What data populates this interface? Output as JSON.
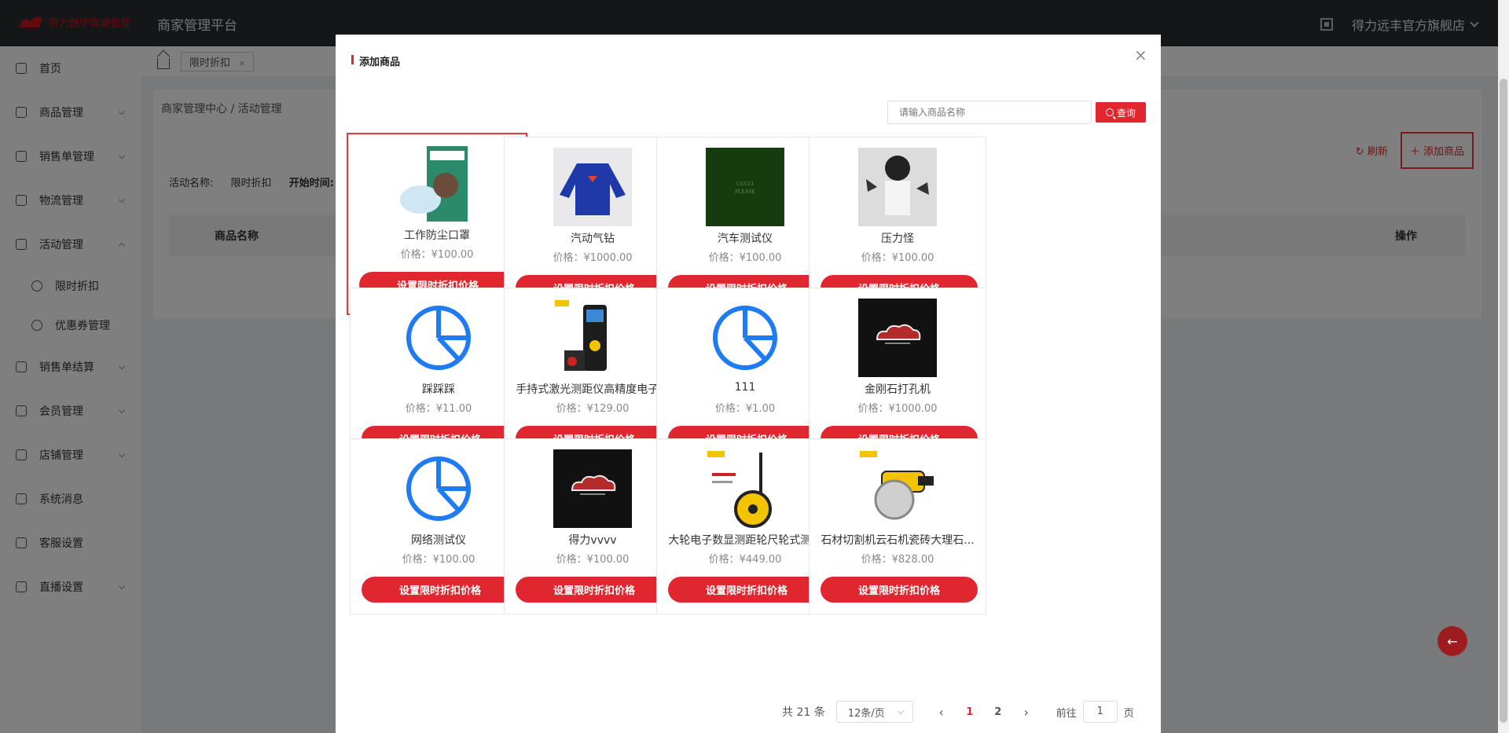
{
  "topbar": {
    "logo_text": "得力数字商城管理",
    "platform_title": "商家管理平台",
    "store_name": "得力远丰官方旗舰店"
  },
  "sidebar": {
    "items": [
      {
        "label": "首页",
        "icon": "home-icon",
        "expandable": false
      },
      {
        "label": "商品管理",
        "icon": "goods-icon",
        "expandable": true
      },
      {
        "label": "销售单管理",
        "icon": "order-icon",
        "expandable": true
      },
      {
        "label": "物流管理",
        "icon": "truck-icon",
        "expandable": true
      },
      {
        "label": "活动管理",
        "icon": "tag-icon",
        "expandable": true,
        "expanded": true
      },
      {
        "label": "销售单结算",
        "icon": "settlement-icon",
        "expandable": true
      },
      {
        "label": "会员管理",
        "icon": "member-icon",
        "expandable": true
      },
      {
        "label": "店铺管理",
        "icon": "store-icon",
        "expandable": true
      },
      {
        "label": "系统消息",
        "icon": "speaker-icon",
        "expandable": false
      },
      {
        "label": "客服设置",
        "icon": "service-icon",
        "expandable": false
      },
      {
        "label": "直播设置",
        "icon": "live-icon",
        "expandable": true
      }
    ],
    "subitems": [
      {
        "label": "限时折扣",
        "icon": "discount-icon"
      },
      {
        "label": "优惠券管理",
        "icon": "coupon-icon"
      }
    ]
  },
  "tabs": {
    "active_tab": "限时折扣",
    "close_glyph": "×"
  },
  "content": {
    "breadcrumb": "商家管理中心 / 活动管理",
    "activity_name_label": "活动名称:",
    "activity_name_value": "限时折扣",
    "start_time_label": "开始时间:",
    "refresh_label": "刷新",
    "add_goods_label": "添加商品",
    "col_goods_name": "商品名称",
    "col_action": "操作"
  },
  "dialog": {
    "title": "添加商品",
    "close_glyph": "×",
    "search_placeholder": "请输入商品名称",
    "search_btn": "查询",
    "set_price_btn": "设置限时折扣价格",
    "price_label": "价格：",
    "products": [
      {
        "name": "工作防尘口罩",
        "price": "¥100.00",
        "image": "mask-product"
      },
      {
        "name": "汽动气钻",
        "price": "¥1000.00",
        "image": "sweater-product"
      },
      {
        "name": "汽车测试仪",
        "price": "¥100.00",
        "image": "green-box-product"
      },
      {
        "name": "压力怪",
        "price": "¥100.00",
        "image": "anime-figure-product"
      },
      {
        "name": "踩踩踩",
        "price": "¥11.00",
        "image": "placeholder-chart"
      },
      {
        "name": "手持式激光测距仪高精度电子...",
        "price": "¥129.00",
        "image": "laser-meter-product"
      },
      {
        "name": "111",
        "price": "¥1.00",
        "image": "placeholder-chart"
      },
      {
        "name": "金刚石打孔机",
        "price": "¥1000.00",
        "image": "cloud-logo-product"
      },
      {
        "name": "网络测试仪",
        "price": "¥100.00",
        "image": "placeholder-chart"
      },
      {
        "name": "得力vvvv",
        "price": "¥100.00",
        "image": "cloud-logo-product"
      },
      {
        "name": "大轮电子数显测距轮尺轮式测...",
        "price": "¥449.00",
        "image": "wheel-meter-product"
      },
      {
        "name": "石材切割机云石机瓷砖大理石...",
        "price": "¥828.00",
        "image": "saw-product"
      }
    ]
  },
  "pager": {
    "total": "共 21 条",
    "page_size": "12条/页",
    "pages": [
      "1",
      "2"
    ],
    "current": "1",
    "goto_label": "前往",
    "goto_value": "1",
    "page_suffix": "页",
    "prev_glyph": "‹",
    "next_glyph": "›"
  },
  "float_btn": {
    "glyph": "←"
  },
  "colors": {
    "accent": "#e0262e",
    "topbar": "#2a2d31",
    "placeholder_blue": "#1e7bf2"
  }
}
